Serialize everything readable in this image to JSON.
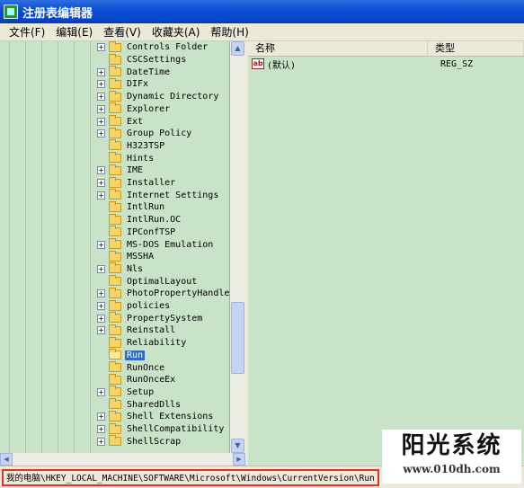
{
  "window": {
    "title": "注册表编辑器"
  },
  "menu": [
    {
      "label": "文件(F)"
    },
    {
      "label": "编辑(E)"
    },
    {
      "label": "查看(V)"
    },
    {
      "label": "收藏夹(A)"
    },
    {
      "label": "帮助(H)"
    }
  ],
  "tree": {
    "items": [
      {
        "label": "Controls Folder",
        "expandable": true
      },
      {
        "label": "CSCSettings",
        "expandable": false
      },
      {
        "label": "DateTime",
        "expandable": true
      },
      {
        "label": "DIFx",
        "expandable": true
      },
      {
        "label": "Dynamic Directory",
        "expandable": true
      },
      {
        "label": "Explorer",
        "expandable": true
      },
      {
        "label": "Ext",
        "expandable": true
      },
      {
        "label": "Group Policy",
        "expandable": true
      },
      {
        "label": "H323TSP",
        "expandable": false
      },
      {
        "label": "Hints",
        "expandable": false
      },
      {
        "label": "IME",
        "expandable": true
      },
      {
        "label": "Installer",
        "expandable": true
      },
      {
        "label": "Internet Settings",
        "expandable": true
      },
      {
        "label": "IntlRun",
        "expandable": false
      },
      {
        "label": "IntlRun.OC",
        "expandable": false
      },
      {
        "label": "IPConfTSP",
        "expandable": false
      },
      {
        "label": "MS-DOS Emulation",
        "expandable": true
      },
      {
        "label": "MSSHA",
        "expandable": false
      },
      {
        "label": "Nls",
        "expandable": true
      },
      {
        "label": "OptimalLayout",
        "expandable": false
      },
      {
        "label": "PhotoPropertyHandler",
        "expandable": true
      },
      {
        "label": "policies",
        "expandable": true
      },
      {
        "label": "PropertySystem",
        "expandable": true
      },
      {
        "label": "Reinstall",
        "expandable": true
      },
      {
        "label": "Reliability",
        "expandable": false
      },
      {
        "label": "Run",
        "expandable": false,
        "selected": true
      },
      {
        "label": "RunOnce",
        "expandable": false
      },
      {
        "label": "RunOnceEx",
        "expandable": false
      },
      {
        "label": "Setup",
        "expandable": true
      },
      {
        "label": "SharedDlls",
        "expandable": false
      },
      {
        "label": "Shell Extensions",
        "expandable": true
      },
      {
        "label": "ShellCompatibility",
        "expandable": true
      },
      {
        "label": "ShellScrap",
        "expandable": true
      }
    ]
  },
  "list": {
    "columns": {
      "name": "名称",
      "type": "类型"
    },
    "rows": [
      {
        "name": "(默认)",
        "type": "REG_SZ",
        "icon": "ab-string-icon"
      }
    ]
  },
  "status": {
    "path": "我的电脑\\HKEY_LOCAL_MACHINE\\SOFTWARE\\Microsoft\\Windows\\CurrentVersion\\Run"
  },
  "watermark": {
    "main": "阳光系统",
    "url": "www.010dh.com"
  },
  "colors": {
    "pane_bg": "#c8e3c8",
    "selection": "#316ac5",
    "title_bar": "#0a4fd6",
    "highlight_box": "#e53030"
  }
}
